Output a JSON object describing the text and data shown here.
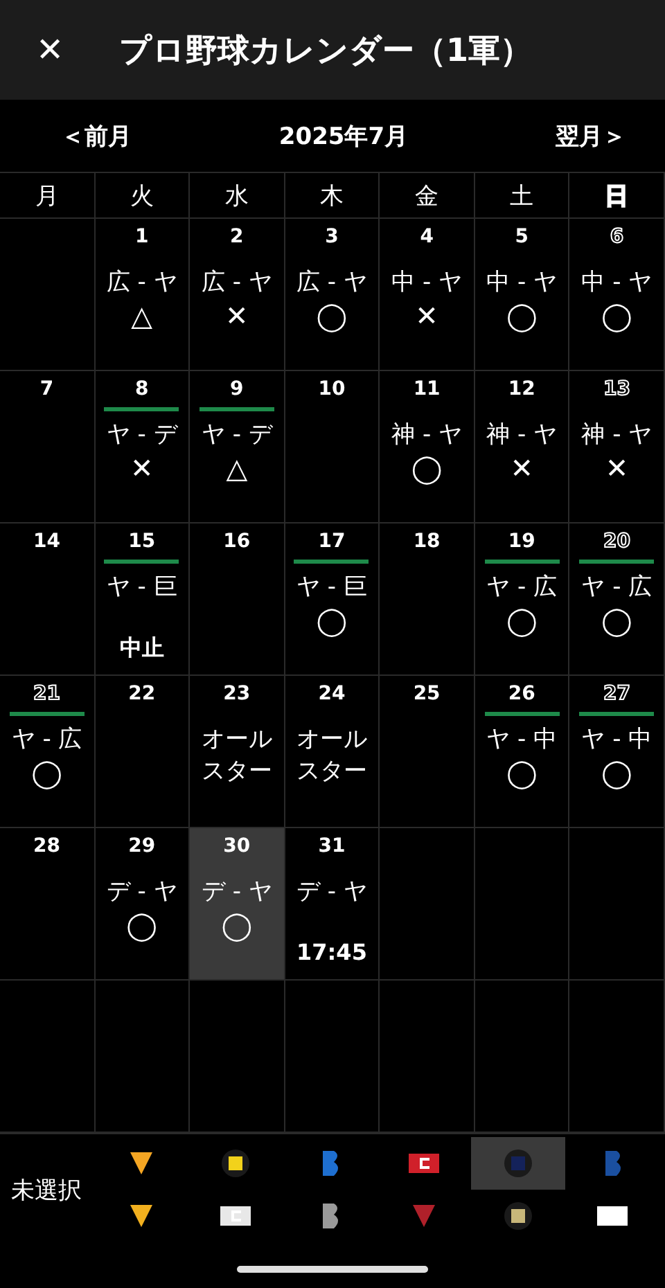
{
  "header": {
    "close": "✕",
    "title": "プロ野球カレンダー（1軍）"
  },
  "nav": {
    "prev": "＜前月",
    "month": "2025年7月",
    "next": "翌月＞"
  },
  "weekdays": [
    {
      "label": "月",
      "holiday": false
    },
    {
      "label": "火",
      "holiday": false
    },
    {
      "label": "水",
      "holiday": false
    },
    {
      "label": "木",
      "holiday": false
    },
    {
      "label": "金",
      "holiday": false
    },
    {
      "label": "土",
      "holiday": false
    },
    {
      "label": "日",
      "holiday": true
    }
  ],
  "weeks": [
    [
      {
        "date": "1",
        "holiday": false,
        "today": false,
        "home": false,
        "match": "広 - ヤ",
        "result": "△"
      },
      {
        "date": "2",
        "holiday": false,
        "today": false,
        "home": false,
        "match": "広 - ヤ",
        "result": "✕"
      },
      {
        "date": "3",
        "holiday": false,
        "today": false,
        "home": false,
        "match": "広 - ヤ",
        "result": "◯"
      },
      {
        "date": "4",
        "holiday": false,
        "today": false,
        "home": false,
        "match": "中 - ヤ",
        "result": "✕"
      },
      {
        "date": "5",
        "holiday": false,
        "today": false,
        "home": false,
        "match": "中 - ヤ",
        "result": "◯"
      },
      {
        "date": "6",
        "holiday": true,
        "today": false,
        "home": false,
        "match": "中 - ヤ",
        "result": "◯"
      }
    ],
    [
      {
        "date": "7",
        "holiday": false,
        "today": false,
        "home": false
      },
      {
        "date": "8",
        "holiday": false,
        "today": false,
        "home": true,
        "match": "ヤ - デ",
        "result": "✕"
      },
      {
        "date": "9",
        "holiday": false,
        "today": false,
        "home": true,
        "match": "ヤ - デ",
        "result": "△"
      },
      {
        "date": "10",
        "holiday": false,
        "today": false,
        "home": false
      },
      {
        "date": "11",
        "holiday": false,
        "today": false,
        "home": false,
        "match": "神 - ヤ",
        "result": "◯"
      },
      {
        "date": "12",
        "holiday": false,
        "today": false,
        "home": false,
        "match": "神 - ヤ",
        "result": "✕"
      },
      {
        "date": "13",
        "holiday": true,
        "today": false,
        "home": false,
        "match": "神 - ヤ",
        "result": "✕"
      }
    ],
    [
      {
        "date": "14",
        "holiday": false,
        "today": false,
        "home": false
      },
      {
        "date": "15",
        "holiday": false,
        "today": false,
        "home": true,
        "match": "ヤ - 巨",
        "note": "中止"
      },
      {
        "date": "16",
        "holiday": false,
        "today": false,
        "home": false
      },
      {
        "date": "17",
        "holiday": false,
        "today": false,
        "home": true,
        "match": "ヤ - 巨",
        "result": "◯"
      },
      {
        "date": "18",
        "holiday": false,
        "today": false,
        "home": false
      },
      {
        "date": "19",
        "holiday": false,
        "today": false,
        "home": true,
        "match": "ヤ - 広",
        "result": "◯"
      },
      {
        "date": "20",
        "holiday": true,
        "today": false,
        "home": true,
        "match": "ヤ - 広",
        "result": "◯"
      }
    ],
    [
      {
        "date": "21",
        "holiday": true,
        "today": false,
        "home": true,
        "match": "ヤ - 広",
        "result": "◯"
      },
      {
        "date": "22",
        "holiday": false,
        "today": false,
        "home": false
      },
      {
        "date": "23",
        "holiday": false,
        "today": false,
        "home": false,
        "match": "オールスター"
      },
      {
        "date": "24",
        "holiday": false,
        "today": false,
        "home": false,
        "match": "オールスター"
      },
      {
        "date": "25",
        "holiday": false,
        "today": false,
        "home": false
      },
      {
        "date": "26",
        "holiday": false,
        "today": false,
        "home": true,
        "match": "ヤ - 中",
        "result": "◯"
      },
      {
        "date": "27",
        "holiday": true,
        "today": false,
        "home": true,
        "match": "ヤ - 中",
        "result": "◯"
      }
    ],
    [
      {
        "date": "28",
        "holiday": false,
        "today": false,
        "home": false
      },
      {
        "date": "29",
        "holiday": false,
        "today": false,
        "home": false,
        "match": "デ - ヤ",
        "result": "◯"
      },
      {
        "date": "30",
        "holiday": false,
        "today": true,
        "home": false,
        "match": "デ - ヤ",
        "result": "◯"
      },
      {
        "date": "31",
        "holiday": false,
        "today": false,
        "home": false,
        "match": "デ - ヤ",
        "note": "17:45"
      }
    ]
  ],
  "team_filter": {
    "label": "未選択",
    "teams": [
      {
        "color": "#f5a623",
        "selected": false
      },
      {
        "color": "#f2d21b",
        "selected": false
      },
      {
        "color": "#1e6fd0",
        "selected": false
      },
      {
        "color": "#d0202a",
        "selected": false
      },
      {
        "color": "#14225a",
        "selected": true
      },
      {
        "color": "#1a4fa0",
        "selected": false
      },
      {
        "color": "#f2b01e",
        "selected": false
      },
      {
        "color": "#e8e8e8",
        "selected": false
      },
      {
        "color": "#9a9a9a",
        "selected": false
      },
      {
        "color": "#b0202a",
        "selected": false
      },
      {
        "color": "#c8b77a",
        "selected": false
      },
      {
        "color": "#ffffff",
        "selected": false
      }
    ]
  }
}
